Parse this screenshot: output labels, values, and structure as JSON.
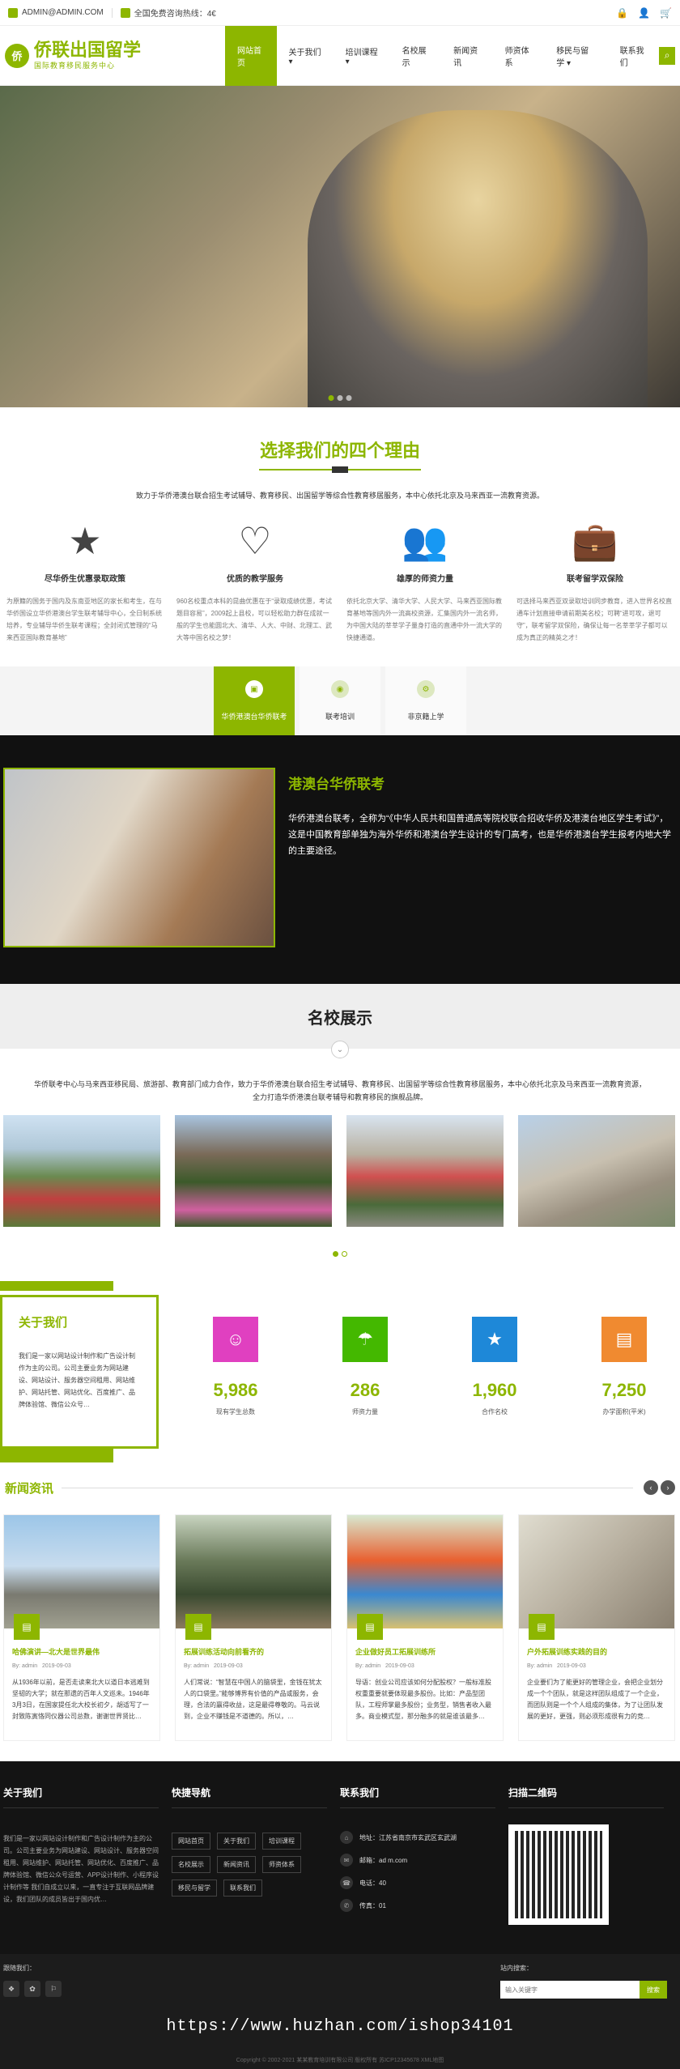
{
  "topbar": {
    "email": "ADMIN@ADMIN.COM",
    "hotline": "全国免费咨询热线：4€",
    "icon_email": "mail-icon",
    "icon_phone": "phone-icon"
  },
  "header": {
    "logo_initial": "侨",
    "logo_name": "侨联出国留学",
    "logo_sub": "国际教育移民服务中心",
    "search_icon": "⌕"
  },
  "nav": {
    "items": [
      "网站首页",
      "关于我们 ▾",
      "培训课程 ▾",
      "名校展示",
      "新闻资讯",
      "师资体系",
      "移民与留学 ▾",
      "联系我们"
    ]
  },
  "hero": {
    "dots": 3
  },
  "reasons_section": {
    "title": "选择我们的四个理由",
    "intro": "致力于华侨港澳台联合招生考试辅导、教育移民、出国留学等综合性教育移居服务，本中心依托北京及马来西亚一流教育资源。",
    "items": [
      {
        "icon": "★",
        "title": "尽华侨生优惠录取政策",
        "text": "为原籍的国务于国内及东南亚地区的家长和考生，在与华侨国设立华侨港澳台学生联考辅导中心，全日制系统培养，专业辅导华侨生联考课程；全封闭式管理的“马来西亚国际教育基地”"
      },
      {
        "icon": "♡",
        "title": "优质的教学服务",
        "text": "960名校重点本科的昆曲优惠在于“录取成绩优惠，考试题目容易”，2009起上县校，可以轻松助力群在成就一般的学生也能圆北大、清华、人大、中财、北理工、武大等中国名校之梦！"
      },
      {
        "icon": "👥",
        "title": "雄厚的师资力量",
        "text": "依托北京大学、清华大学、人民大学、马来西亚国际教育基地等国内外一流高校资源，汇集国内外一流名师，为中国大陆的莘莘学子量身打造的直通中外一流大学的快捷通道。"
      },
      {
        "icon": "💼",
        "title": "联考留学双保险",
        "text": "可选择马来西亚双录取培训同步教育，进入世界名校直通车计划直接申请前期美名校；可聘“进可攻，退可守”，联考留学双保险，确保让每一名莘莘学子都可以成为真正的精英之才！"
      }
    ]
  },
  "tabs": {
    "items": [
      {
        "icon": "▣",
        "label": "华侨港澳台华侨联考"
      },
      {
        "icon": "◉",
        "label": "联考培训"
      },
      {
        "icon": "⚙",
        "label": "非京籍上学"
      }
    ]
  },
  "feature": {
    "title": "港澳台华侨联考",
    "text": "华侨港澳台联考，全称为“《中华人民共和国普通高等院校联合招收华侨及港澳台地区学生考试》”，这是中国教育部单独为海外华侨和港澳台学生设计的专门高考，也是华侨港澳台学生报考内地大学的主要途径。"
  },
  "schools_section": {
    "title": "名校展示",
    "down_icon": "⌄",
    "intro": "华侨联考中心与马来西亚移民局、旅游部、教育部门成力合作，致力于华侨港澳台联合招生考试辅导、教育移民、出国留学等综合性教育移居服务，本中心依托北京及马来西亚一流教育资源，全力打造华侨港澳台联考辅导和教育移民的旗舰品牌。"
  },
  "about": {
    "title": "关于我们",
    "text": "我们是一家以网站设计制作和广告设计制作为主的公司。公司主要业务为网站建设、网站设计、服务器空间租用、网站维护、网站托管、网站优化、百度推广、品牌体验馆、微信公众号…",
    "stats": [
      {
        "icon": "☺",
        "num": "5,986",
        "label": "现有学生总数",
        "color": "#e040c0"
      },
      {
        "icon": "☂",
        "num": "286",
        "label": "师资力量",
        "color": "#44b800"
      },
      {
        "icon": "★",
        "num": "1,960",
        "label": "合作名校",
        "color": "#1e88d8"
      },
      {
        "icon": "▤",
        "num": "7,250",
        "label": "办学面积(平米)",
        "color": "#f08a30"
      }
    ]
  },
  "news": {
    "title": "新闻资讯",
    "prev": "‹",
    "next": "›",
    "items": [
      {
        "title": "哈佛演讲—北大是世界最伟",
        "author": "By: admin",
        "date": "2019-09-03",
        "text": "从1936年以前，是否走读来北大以道日本逃难到坚韧的大学；就在那遗的百年人文巡未。1946年3月3日，在国家提任北大校长初夕，胡适写了一封致陈寅恪同仪器公司总数，谢谢世界贤比…"
      },
      {
        "title": "拓展训练活动向前看齐的",
        "author": "By: admin",
        "date": "2019-09-03",
        "text": "人们常说：“智慧在中国人的脑袋里，金钱在犹太人的口袋里。”能够博界有价值的产品或服务，会理，合法的赢得收益，这是最得尊敬的。马云说到，企业不赚钱是不道德的。所以，…"
      },
      {
        "title": "企业做好员工拓展训练所",
        "author": "By: admin",
        "date": "2019-09-03",
        "text": "导语：创业公司应该如何分配股权？一般标准股权重重要就要体现最多股份。比如：产品型团队，工程师掌最多股份；业务型，销售者收入最多。商业模式型，那分融多的就是谁该最多…"
      },
      {
        "title": "户外拓展训练实践的目的",
        "author": "By: admin",
        "date": "2019-09-03",
        "text": "企业要们为了能更好的管理企业，会把企业划分成一个个团队，就是这样团队组成了一个企业，而团队则是一个个人组成的集体，为了让团队发展的更好，更强，则必须形成很有力的竞…"
      }
    ]
  },
  "footer": {
    "about_title": "关于我们",
    "about_text": "我们是一家以网站设计制作和广告设计制作为主的公司。公司主要业务为网站建设、网站设计、服务器空间租用、网站维护、网站托管、网站优化、百度推广、品牌体验馆、微信公众号运营、APP设计制作、小程序设计制作等 我们自成立以来，一直专注于互联网品牌建设，我们团队的成员皆出于国内优…",
    "links_title": "快捷导航",
    "links": [
      "网站首页",
      "关于我们",
      "培训课程",
      "名校展示",
      "新闻资讯",
      "师资体系",
      "移民与留学",
      "联系我们"
    ],
    "contact_title": "联系我们",
    "contacts": [
      {
        "icon": "⌂",
        "text": "地址：江苏省南京市玄武区玄武湖"
      },
      {
        "icon": "✉",
        "text": "邮箱：ad          m.com"
      },
      {
        "icon": "☎",
        "text": "电话：40"
      },
      {
        "icon": "✆",
        "text": "传真：01"
      }
    ],
    "qr_title": "扫描二维码"
  },
  "bottom": {
    "follow_label": "跟随我们：",
    "socials": [
      "❖",
      "✿",
      "⚐"
    ],
    "search_label": "站内搜索：",
    "search_placeholder": "输入关键字",
    "search_button": "搜索",
    "watermark": "https://www.huzhan.com/ishop34101",
    "copyright": "Copyright © 2002-2021 某某教育培训有限公司 版权所有 苏ICP12345678 XML地图"
  }
}
